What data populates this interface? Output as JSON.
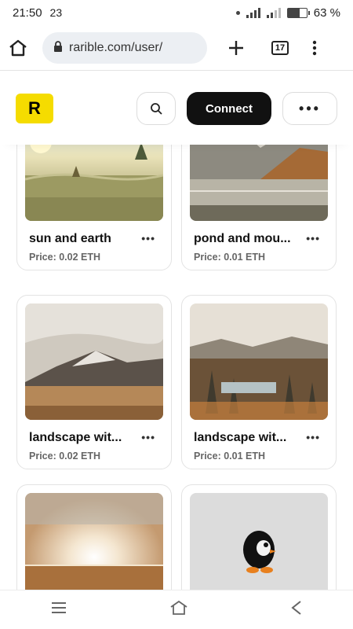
{
  "status": {
    "time": "21:50",
    "extra": "23",
    "battery_pct": "63 %",
    "battery_level": 0.63
  },
  "browser": {
    "url": "rarible.com/user/",
    "tab_count": "17"
  },
  "header": {
    "logo_letter": "R",
    "connect_label": "Connect",
    "more_label": "•••"
  },
  "cards": [
    {
      "title": "sun and earth",
      "price": "Price: 0.02 ETH"
    },
    {
      "title": "pond and mou...",
      "price": "Price: 0.01 ETH"
    },
    {
      "title": "landscape wit...",
      "price": "Price: 0.02 ETH"
    },
    {
      "title": "landscape wit...",
      "price": "Price: 0.01 ETH"
    },
    {
      "title": "",
      "price": ""
    },
    {
      "title": "",
      "price": ""
    }
  ],
  "card_menu_label": "•••",
  "icons": [
    "home-icon",
    "lock-icon",
    "plus-icon",
    "tabs-icon",
    "kebab-menu-icon",
    "search-icon",
    "recent-apps-icon",
    "nav-home-icon",
    "back-icon"
  ]
}
